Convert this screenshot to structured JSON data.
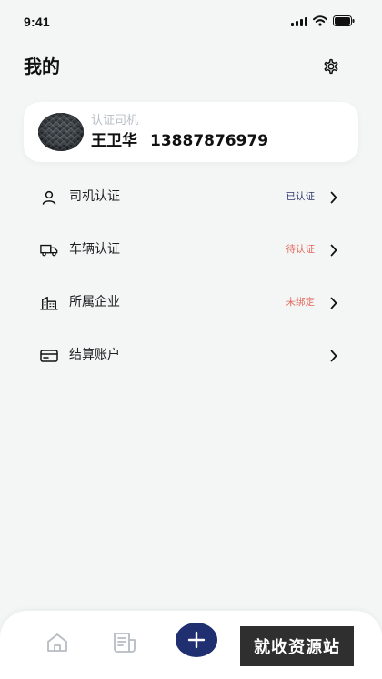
{
  "status_bar": {
    "time": "9:41",
    "icons": [
      "signal-icon",
      "wifi-icon",
      "battery-icon"
    ]
  },
  "header": {
    "title": "我的",
    "settings_icon": "gear-icon"
  },
  "profile": {
    "role": "认证司机",
    "name": "王卫华",
    "phone": "13887876979",
    "avatar": "avatar-image"
  },
  "menu": {
    "items": [
      {
        "label": "司机认证",
        "status": "已认证",
        "icon": "user-icon",
        "status_color": "#2e376c"
      },
      {
        "label": "车辆认证",
        "status": "待认证",
        "icon": "truck-icon",
        "status_color": "#e2675b"
      },
      {
        "label": "所属企业",
        "status": "未绑定",
        "icon": "building-icon",
        "status_color": "#e2675b"
      },
      {
        "label": "结算账户",
        "status": "",
        "icon": "card-icon",
        "status_color": ""
      }
    ]
  },
  "tab_bar": {
    "items": [
      "home-icon",
      "orders-icon",
      "add-icon"
    ]
  },
  "watermark": {
    "text": "就收资源站"
  },
  "colors": {
    "background": "#f4f6f6",
    "card": "#ffffff",
    "primary": "#1f2f70",
    "status_done": "#2e376c",
    "status_warn": "#e2675b",
    "role_text": "#b9bec4"
  }
}
